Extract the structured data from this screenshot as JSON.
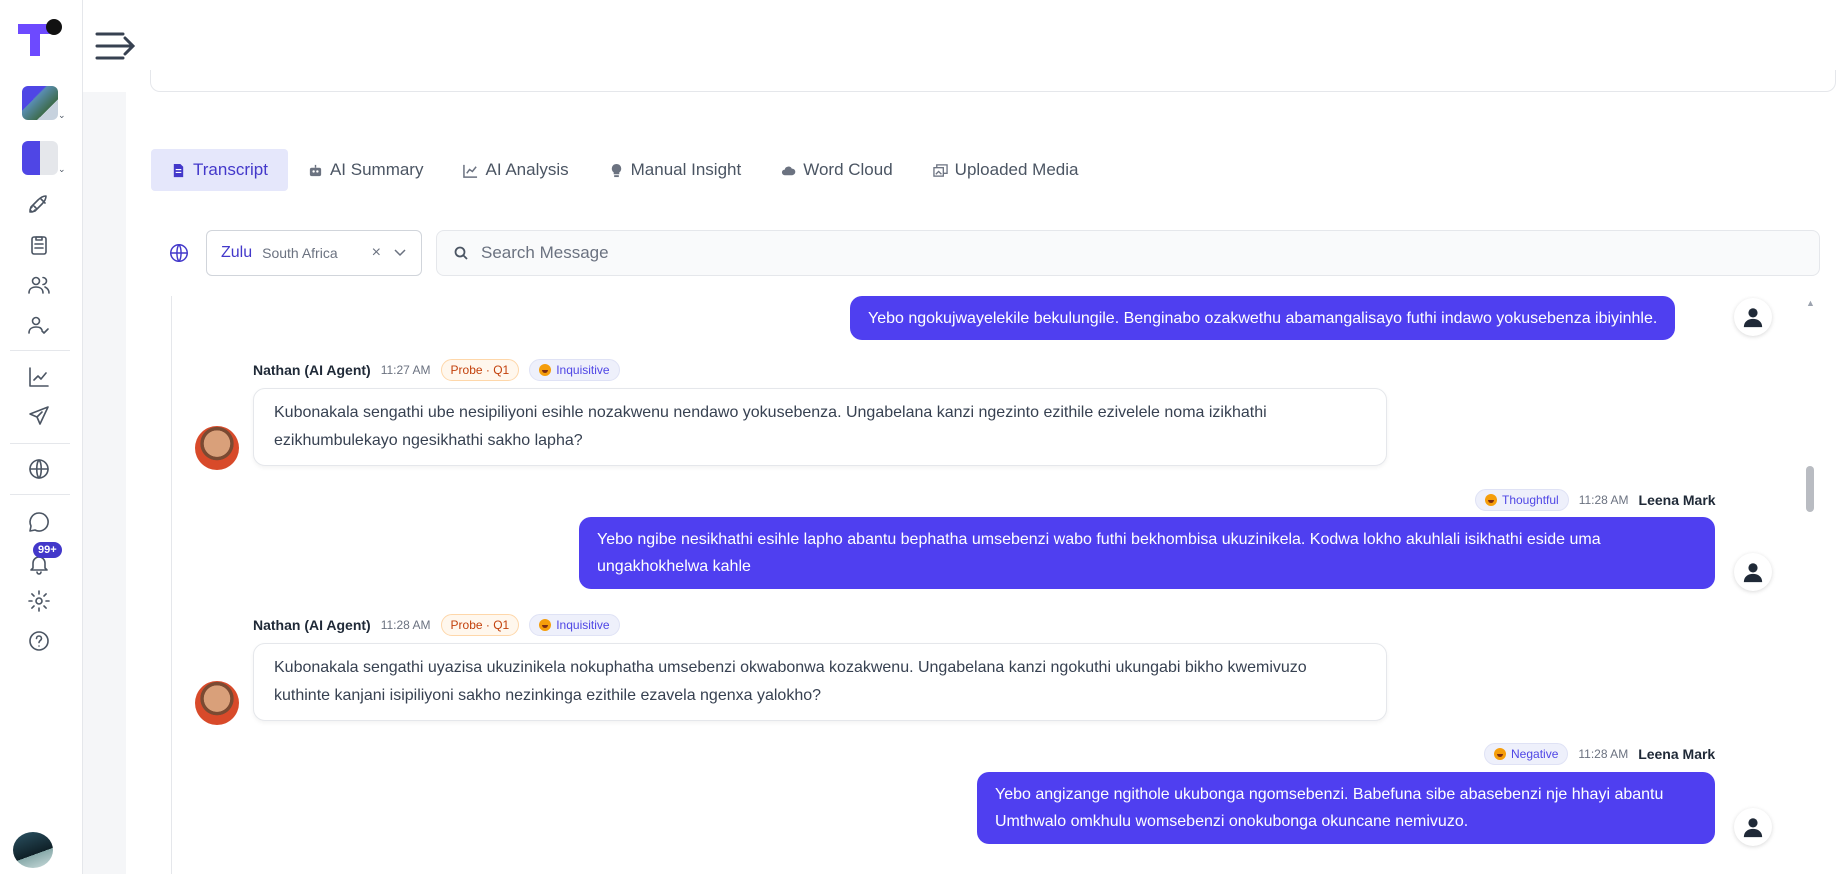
{
  "tabs": [
    {
      "label": "Transcript",
      "icon": "document-icon",
      "active": true
    },
    {
      "label": "AI Summary",
      "icon": "robot-icon"
    },
    {
      "label": "AI Analysis",
      "icon": "chart-icon"
    },
    {
      "label": "Manual Insight",
      "icon": "lightbulb-icon"
    },
    {
      "label": "Word Cloud",
      "icon": "cloud-icon"
    },
    {
      "label": "Uploaded Media",
      "icon": "media-icon"
    }
  ],
  "language": {
    "name": "Zulu",
    "region": "South Africa"
  },
  "search": {
    "placeholder": "Search Message"
  },
  "notifications": {
    "badge": "99+"
  },
  "messages": [
    {
      "text": "Yebo ngokujwayelekile bekulungile. Benginabo ozakwethu abamangalisayo futhi indawo yokusebenza ibiyinhle."
    },
    {
      "name": "Nathan (AI Agent)",
      "time": "11:27 AM",
      "probe": "Probe · Q1",
      "mood": "Inquisitive",
      "text": "Kubonakala sengathi ube nesipiliyoni esihle nozakwenu nendawo yokusebenza. Ungabelana kanzi ngezinto ezithile ezivelele noma izikhathi ezikhumbulekayo ngesikhathi sakho lapha?"
    },
    {
      "name": "Leena Mark",
      "time": "11:28 AM",
      "mood": "Thoughtful",
      "text": "Yebo ngibe nesikhathi esihle lapho abantu bephatha umsebenzi wabo futhi bekhombisa ukuzinikela. Kodwa lokho akuhlali isikhathi eside uma ungakhokhelwa kahle"
    },
    {
      "name": "Nathan (AI Agent)",
      "time": "11:28 AM",
      "probe": "Probe · Q1",
      "mood": "Inquisitive",
      "text": "Kubonakala sengathi uyazisa ukuzinikela nokuphatha umsebenzi okwabonwa kozakwenu. Ungabelana kanzi ngokuthi ukungabi bikho kwemivuzo kuthinte kanjani isipiliyoni sakho nezinkinga ezithile ezavela ngenxa yalokho?"
    },
    {
      "name": "Leena Mark",
      "time": "11:28 AM",
      "mood": "Negative",
      "text": "Yebo angizange ngithole ukubonga ngomsebenzi. Babefuna sibe abasebenzi nje hhayi abantu Umthwalo omkhulu womsebenzi onokubonga okuncane nemivuzo."
    }
  ]
}
